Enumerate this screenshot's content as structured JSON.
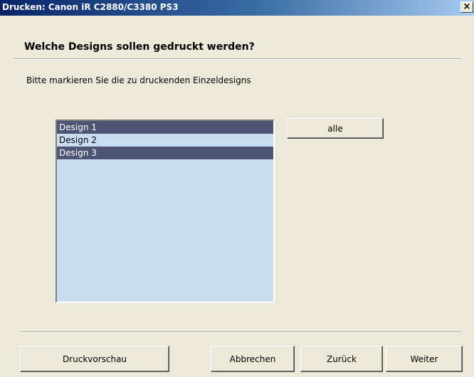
{
  "window": {
    "title": "Drucken: Canon iR C2880/C3380 PS3",
    "close_label": "×"
  },
  "page": {
    "heading": "Welche Designs sollen gedruckt werden?",
    "instruction": "Bitte markieren Sie die zu druckenden Einzeldesigns"
  },
  "designs": {
    "items": [
      {
        "label": "Design 1",
        "selected": true
      },
      {
        "label": "Design 2",
        "selected": false
      },
      {
        "label": "Design 3",
        "selected": true
      }
    ],
    "select_all_label": "alle"
  },
  "footer": {
    "preview_label": "Druckvorschau",
    "cancel_label": "Abbrechen",
    "back_label": "Zurück",
    "next_label": "Weiter"
  },
  "colors": {
    "selection_background": "#4e5574",
    "list_background": "#c8ddf2",
    "window_background": "#ece9d8"
  }
}
